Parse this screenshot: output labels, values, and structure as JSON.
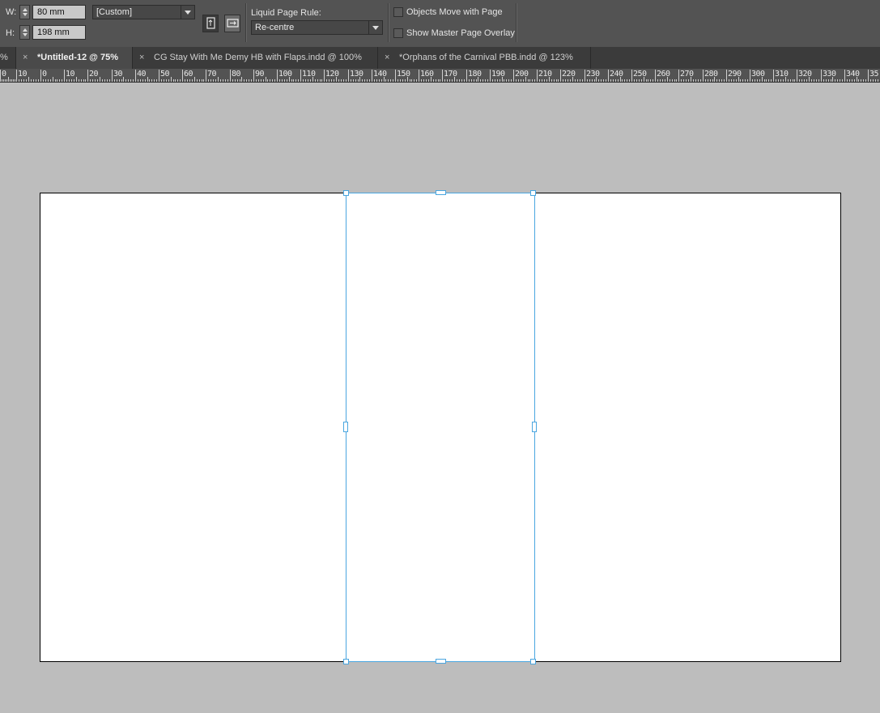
{
  "control_bar": {
    "width_label": "W:",
    "width_value": "80 mm",
    "height_label": "H:",
    "height_value": "198 mm",
    "preset_value": "[Custom]",
    "liquid_rule_label": "Liquid Page Rule:",
    "liquid_rule_value": "Re-centre",
    "objects_move_label": "Objects Move with Page",
    "objects_move_checked": false,
    "show_master_label": "Show Master Page Overlay",
    "show_master_checked": false
  },
  "tabs": [
    {
      "label": "%",
      "closable": false,
      "active": false
    },
    {
      "label": "*Untitled-12 @ 75%",
      "closable": true,
      "active": true
    },
    {
      "label": "CG Stay With Me Demy HB with Flaps.indd @ 100%",
      "closable": true,
      "active": false
    },
    {
      "label": "*Orphans of the Carnival PBB.indd @ 123%",
      "closable": true,
      "active": false
    }
  ],
  "ruler": {
    "labels": [
      "0",
      "10",
      "0",
      "10",
      "20",
      "30",
      "40",
      "50",
      "60",
      "70",
      "80",
      "90",
      "100",
      "110",
      "120",
      "130",
      "140",
      "150",
      "160",
      "170",
      "180",
      "190",
      "200",
      "210",
      "220",
      "230",
      "240",
      "250",
      "260",
      "270",
      "280",
      "290",
      "300",
      "310",
      "320",
      "330",
      "340",
      "35"
    ]
  },
  "colors": {
    "selection": "#4aa6e0",
    "pasteboard": "#bdbdbd",
    "page": "#ffffff"
  }
}
